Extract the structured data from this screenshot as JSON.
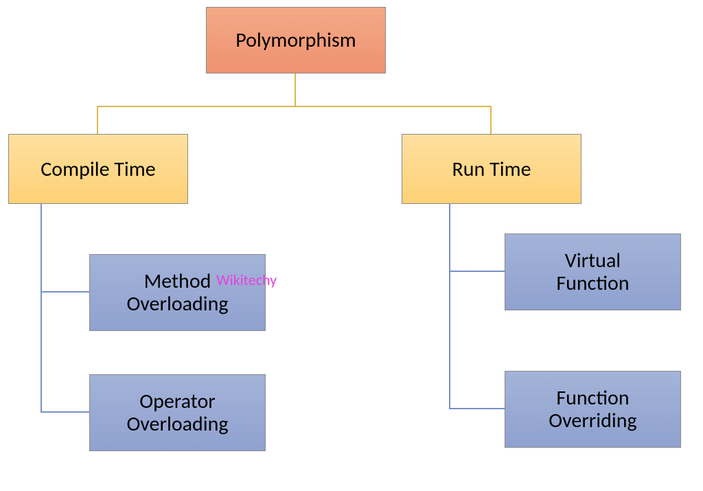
{
  "root": {
    "label": "Polymorphism"
  },
  "branches": {
    "left": {
      "label": "Compile Time",
      "children": [
        {
          "label": "Method\nOverloading"
        },
        {
          "label": "Operator\nOverloading"
        }
      ]
    },
    "right": {
      "label": "Run Time",
      "children": [
        {
          "label": "Virtual\nFunction"
        },
        {
          "label": "Function\nOverriding"
        }
      ]
    }
  },
  "watermark": "Wikitechy",
  "colors": {
    "root": "#ee9270",
    "branch": "#fdd176",
    "leaf": "#8fa1cf",
    "connector_top": "#d9b94e",
    "connector_side": "#7a8fc5"
  }
}
